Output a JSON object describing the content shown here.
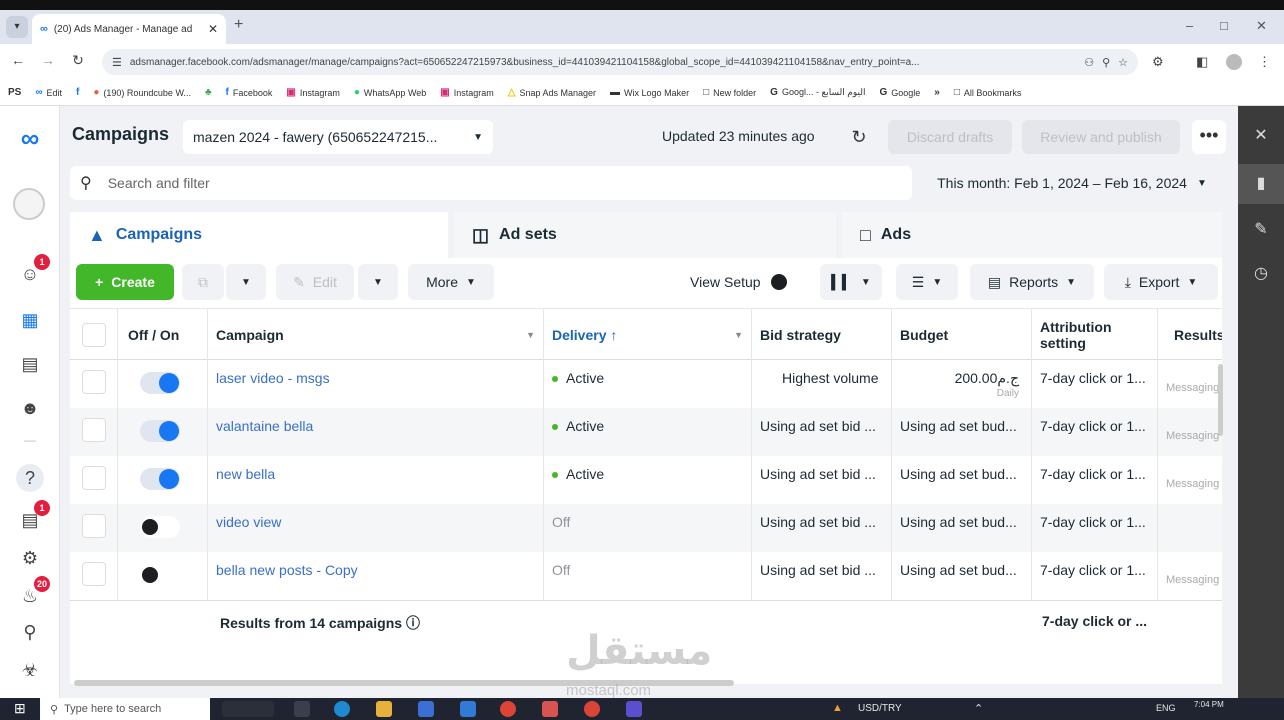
{
  "browser": {
    "tab_title": "(20) Ads Manager - Manage ad",
    "url": "adsmanager.facebook.com/adsmanager/manage/campaigns?act=650652247215973&business_id=441039421104158&global_scope_id=441039421104158&nav_entry_point=a...",
    "bookmarks": [
      "Edit",
      "(190) Roundcube W...",
      "Facebook",
      "Instagram",
      "WhatsApp Web",
      "Instagram",
      "Snap Ads Manager",
      "Wix Logo Maker",
      "New folder",
      "Googl... - اليوم السابع",
      "Google"
    ],
    "all_bookmarks": "All Bookmarks"
  },
  "nav_badges": {
    "notifications_top": "1",
    "help_badge": "1",
    "alerts": "20"
  },
  "header": {
    "title": "Campaigns",
    "account": "mazen 2024 - fawery (650652247215...",
    "updated": "Updated 23 minutes ago",
    "discard": "Discard drafts",
    "review": "Review and publish",
    "more_dots": "•••"
  },
  "search": {
    "placeholder": "Search and filter"
  },
  "date_range": "This month: Feb 1, 2024 – Feb 16, 2024",
  "tabs": {
    "campaigns": "Campaigns",
    "adsets": "Ad sets",
    "ads": "Ads"
  },
  "toolbar": {
    "create": "Create",
    "edit": "Edit",
    "more": "More",
    "view_setup": "View Setup",
    "reports": "Reports",
    "export": "Export"
  },
  "table": {
    "headers": {
      "offon": "Off / On",
      "campaign": "Campaign",
      "delivery": "Delivery ↑",
      "bid": "Bid strategy",
      "budget": "Budget",
      "attribution": "Attribution setting",
      "results": "Results"
    },
    "rows": [
      {
        "name": "laser video - msgs",
        "on": true,
        "delivery": "Active",
        "bid": "Highest volume",
        "budget": "200.00ج.م",
        "budget_sub": "Daily",
        "attribution": "7-day click or 1...",
        "results": "Messaging"
      },
      {
        "name": "valantaine bella",
        "on": true,
        "delivery": "Active",
        "bid": "Using ad set bid ...",
        "budget": "Using ad set bud...",
        "budget_sub": "",
        "attribution": "7-day click or 1...",
        "results": "Messaging"
      },
      {
        "name": "new bella",
        "on": true,
        "delivery": "Active",
        "bid": "Using ad set bid ...",
        "budget": "Using ad set bud...",
        "budget_sub": "",
        "attribution": "7-day click or 1...",
        "results": "Messaging"
      },
      {
        "name": "video view",
        "on": false,
        "delivery": "Off",
        "bid": "Using ad set bid ...",
        "budget": "Using ad set bud...",
        "budget_sub": "",
        "attribution": "7-day click or 1...",
        "results": ""
      },
      {
        "name": "bella new posts - Copy",
        "on": false,
        "delivery": "Off",
        "bid": "Using ad set bid ...",
        "budget": "Using ad set bud...",
        "budget_sub": "",
        "attribution": "7-day click or 1...",
        "results": "Messaging"
      }
    ],
    "footer": {
      "summary": "Results from 14 campaigns",
      "attribution": "7-day click or ..."
    }
  },
  "taskbar": {
    "search_placeholder": "Type here to search",
    "ticker": "USD/TRY",
    "lang": "ENG",
    "time": "7:04 PM"
  },
  "watermark": {
    "arabic": "مستقل",
    "latin": "mostaql.com"
  }
}
